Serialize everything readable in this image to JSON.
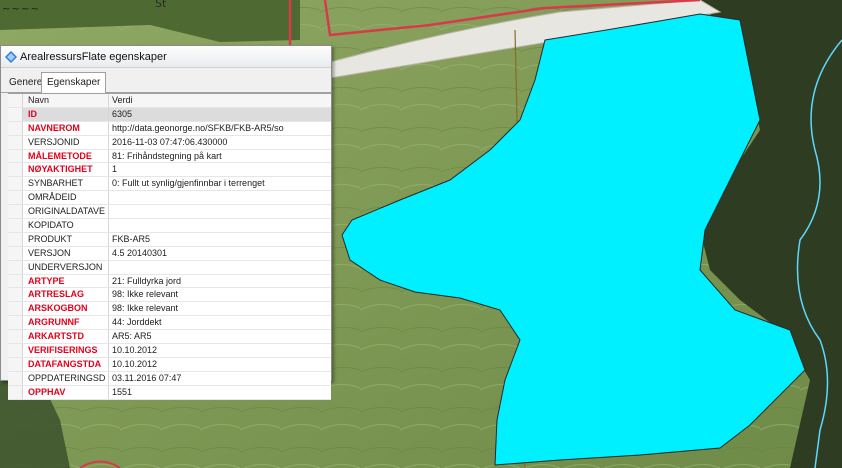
{
  "map": {
    "label_top": "St",
    "label_left": "~ ~ ~ ~",
    "colors": {
      "polygon_fill": "#00f0ff",
      "boundary": "#d83a4a",
      "field": "#7f9a55",
      "forest": "#2b3a1f",
      "road": "#e8e6e0",
      "stream": "#5ed8ff"
    }
  },
  "dialog": {
    "title": "ArealressursFlate egenskaper",
    "icon": "diamond-icon",
    "tabs": [
      {
        "label": "Generelt",
        "active": false
      },
      {
        "label": "Egenskaper",
        "active": true
      }
    ],
    "columns": {
      "name": "Navn",
      "value": "Verdi"
    },
    "rows": [
      {
        "name": "ID",
        "value": "6305",
        "required": true
      },
      {
        "name": "NAVNEROM",
        "value": "http://data.geonorge.no/SFKB/FKB-AR5/so",
        "required": true
      },
      {
        "name": "VERSJONID",
        "value": "2016-11-03 07:47:06.430000",
        "required": false
      },
      {
        "name": "MÅLEMETODE",
        "value": "81: Frihåndstegning på kart",
        "required": true
      },
      {
        "name": "NØYAKTIGHET",
        "value": "1",
        "required": true
      },
      {
        "name": "SYNBARHET",
        "value": "0: Fullt ut synlig/gjenfinnbar i terrenget",
        "required": false
      },
      {
        "name": "OMRÅDEID",
        "value": "",
        "required": false
      },
      {
        "name": "ORIGINALDATAVE",
        "value": "",
        "required": false
      },
      {
        "name": "KOPIDATO",
        "value": "",
        "required": false
      },
      {
        "name": "PRODUKT",
        "value": "FKB-AR5",
        "required": false
      },
      {
        "name": "VERSJON",
        "value": "4.5 20140301",
        "required": false
      },
      {
        "name": "UNDERVERSJON",
        "value": "",
        "required": false
      },
      {
        "name": "ARTYPE",
        "value": "21: Fulldyrka jord",
        "required": true
      },
      {
        "name": "ARTRESLAG",
        "value": "98: Ikke relevant",
        "required": true
      },
      {
        "name": "ARSKOGBON",
        "value": "98: Ikke relevant",
        "required": true
      },
      {
        "name": "ARGRUNNF",
        "value": "44: Jorddekt",
        "required": true
      },
      {
        "name": "ARKARTSTD",
        "value": "AR5: AR5",
        "required": true
      },
      {
        "name": "VERIFISERINGS",
        "value": "10.10.2012",
        "required": true
      },
      {
        "name": "DATAFANGSTDA",
        "value": "10.10.2012",
        "required": true
      },
      {
        "name": "OPPDATERINGSD",
        "value": "03.11.2016 07:47",
        "required": false
      },
      {
        "name": "OPPHAV",
        "value": "1551",
        "required": true
      }
    ]
  }
}
